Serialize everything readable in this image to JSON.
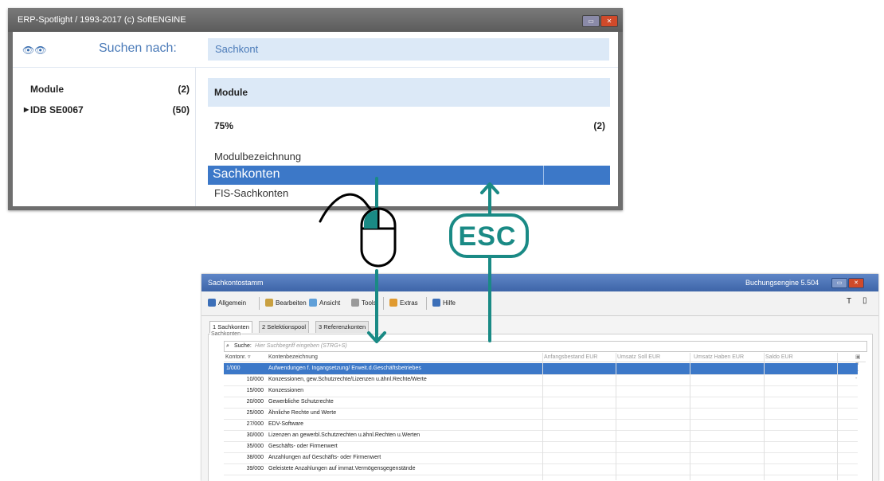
{
  "spotlight": {
    "title": "ERP-Spotlight / 1993-2017 (c) SoftENGINE",
    "search_label": "Suchen nach:",
    "search_value": "Sachkont",
    "left_items": [
      {
        "label": "Module",
        "count": "(2)"
      },
      {
        "label": "IDB SE0067",
        "count": "(50)"
      }
    ],
    "result_header": "Module",
    "match_label": "75%",
    "match_count": "(2)",
    "column_header": "Modulbezeichnung",
    "results": [
      "Sachkonten",
      "FIS-Sachkonten"
    ]
  },
  "annotation": {
    "esc_label": "ESC",
    "accent_color": "#1a8a85"
  },
  "buchung": {
    "title": "Sachkontostamm",
    "app_label": "Buchungsengine 5.504",
    "toolbar": [
      "Allgemein",
      "Bearbeiten",
      "Ansicht",
      "Tools",
      "Extras",
      "Hilfe"
    ],
    "tabs": [
      "1 Sachkonten",
      "2 Selektionspool",
      "3 Referenzkonten"
    ],
    "group_label": "Sachkonten",
    "search_label": "Suche:",
    "search_placeholder": "Hier Suchbegriff eingeben (STRG+S)",
    "columns": [
      "Kontonr.",
      "Kontenbezeichnung",
      "Anfangsbestand EUR",
      "Umsatz Soll EUR",
      "Umsatz Haben EUR",
      "Saldo EUR"
    ],
    "rows": [
      {
        "nr": "1/000",
        "bez": "Aufwendungen f. Ingangsetzung/ Erweit.d.Geschäftsbetriebes"
      },
      {
        "nr": "10/000",
        "bez": "Konzessionen, gew.Schutzrechte/Lizenzen u.ähnl.Rechte/Werte"
      },
      {
        "nr": "15/000",
        "bez": "Konzessionen"
      },
      {
        "nr": "20/000",
        "bez": "Gewerbliche Schutzrechte"
      },
      {
        "nr": "25/000",
        "bez": "Ähnliche Rechte und Werte"
      },
      {
        "nr": "27/000",
        "bez": "EDV-Software"
      },
      {
        "nr": "30/000",
        "bez": "Lizenzen an gewerbl.Schutzrechten u.ähnl.Rechten u.Werten"
      },
      {
        "nr": "35/000",
        "bez": "Geschäfts- oder Firmenwert"
      },
      {
        "nr": "38/000",
        "bez": "Anzahlungen auf Geschäfts- oder Firmenwert"
      },
      {
        "nr": "39/000",
        "bez": "Geleistete Anzahlungen auf immat.Vermögensgegenstände"
      }
    ]
  }
}
